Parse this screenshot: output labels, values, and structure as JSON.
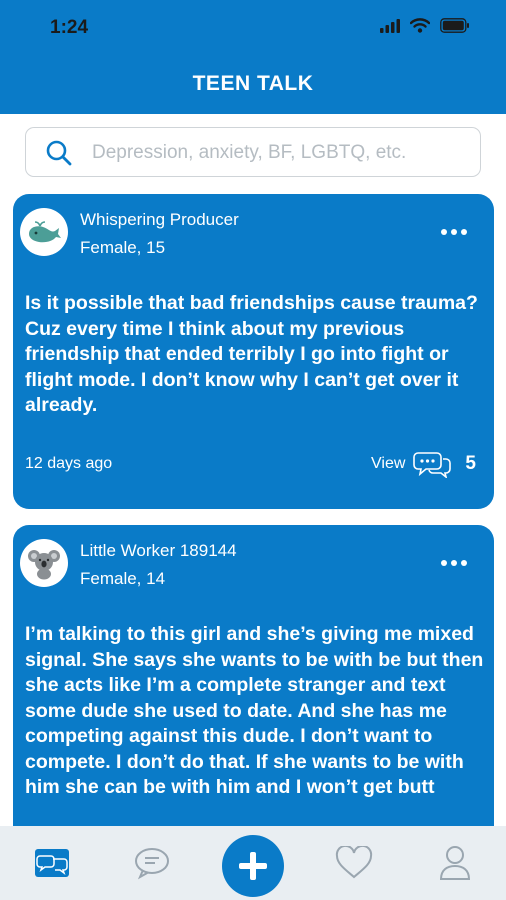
{
  "status": {
    "time": "1:24"
  },
  "app": {
    "title": "TEEN TALK"
  },
  "search": {
    "placeholder": "Depression, anxiety, BF, LGBTQ, etc."
  },
  "posts": [
    {
      "avatar_icon": "whale-icon",
      "username": "Whispering Producer",
      "meta": "Female, 15",
      "body": "Is it possible that bad friendships cause trauma? Cuz every time I think about my previous friendship that ended terribly I go into fight or flight mode. I don’t know why I can’t get over it already.",
      "time_ago": "12 days ago",
      "view_label": "View",
      "comment_count": "5"
    },
    {
      "avatar_icon": "koala-icon",
      "username": "Little Worker 189144",
      "meta": "Female, 14",
      "body": "I’m talking to this girl and she’s giving me mixed signal. She says she wants to be with be but then she acts like I’m a complete stranger and text some dude she used to date. And she has me competing against this dude. I don’t want to compete. I don’t do that. If she wants to be with him she can be with him and I won’t get butt"
    }
  ],
  "colors": {
    "brand": "#0a7bc8",
    "tabbar": "#e9eef2",
    "tab_icon": "#9aa6b0"
  },
  "tabs": [
    "feed-tab-icon",
    "chat-icon",
    "plus-icon",
    "heart-icon",
    "profile-icon"
  ]
}
